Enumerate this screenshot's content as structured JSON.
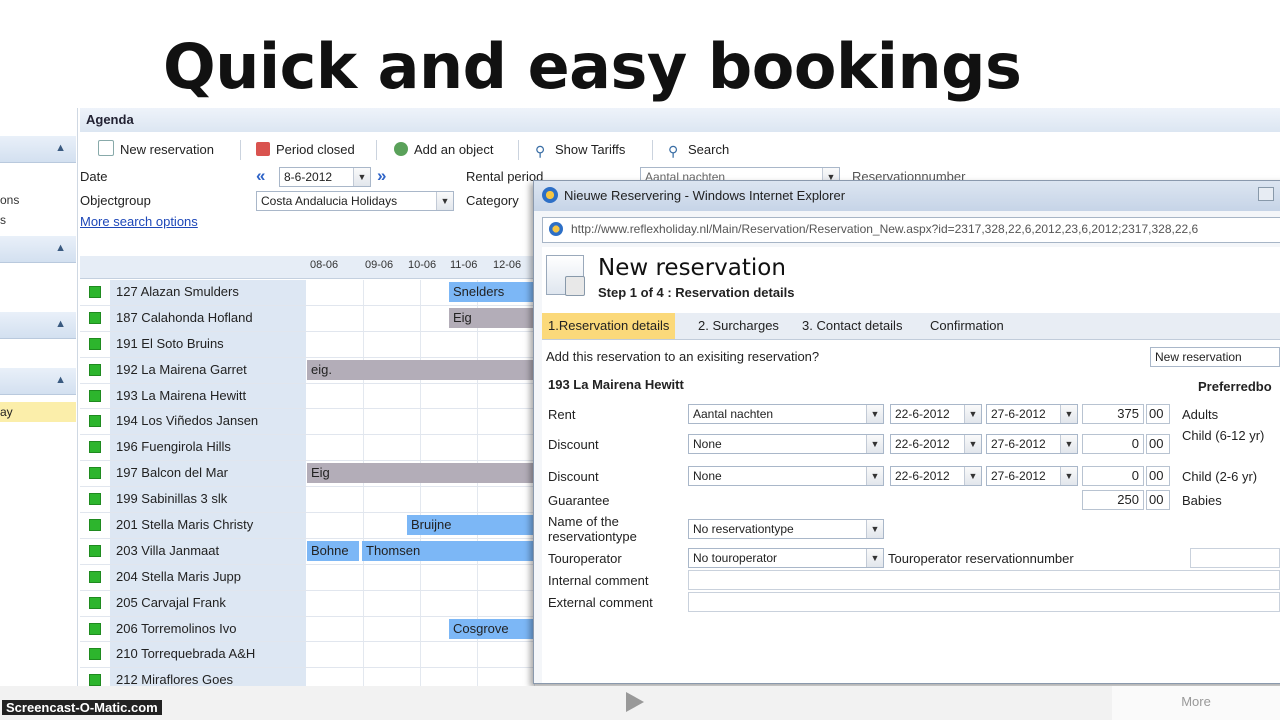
{
  "headline": "Quick and easy bookings",
  "left_panel": {
    "text_ons": "ons",
    "text_s": "s",
    "highlight": "ay"
  },
  "agenda": {
    "title": "Agenda",
    "toolbar": {
      "new_reservation": "New reservation",
      "period_closed": "Period closed",
      "add_object": "Add an object",
      "show_tariffs": "Show Tariffs",
      "search": "Search"
    },
    "filters": {
      "date_label": "Date",
      "date_value": "8-6-2012",
      "objectgroup_label": "Objectgroup",
      "objectgroup_value": "Costa Andalucia Holidays",
      "more_options": "More search options",
      "rental_period_label": "Rental period",
      "rental_period_value": "Aantal nachten",
      "category_label": "Category",
      "reservationnumber_label": "Reservationnumber"
    },
    "dates": [
      "08-06",
      "09-06",
      "10-06",
      "11-06",
      "12-06"
    ],
    "rows": [
      {
        "name": "127 Alazan Smulders",
        "bar": {
          "text": "Snelders",
          "color": "blue"
        }
      },
      {
        "name": "187 Calahonda Hofland",
        "bar": {
          "text": "Eig",
          "color": "gray"
        }
      },
      {
        "name": "191 El Soto Bruins"
      },
      {
        "name": "192 La Mairena Garret",
        "bar": {
          "text": "eig.",
          "color": "gray"
        }
      },
      {
        "name": "193 La Mairena Hewitt"
      },
      {
        "name": "194 Los Viñedos Jansen"
      },
      {
        "name": "196 Fuengirola Hills"
      },
      {
        "name": "197 Balcon del Mar",
        "bar": {
          "text": "Eig",
          "color": "gray"
        }
      },
      {
        "name": "199 Sabinillas 3 slk"
      },
      {
        "name": "201 Stella Maris Christy",
        "bar": {
          "text": "Bruijne",
          "color": "blue"
        }
      },
      {
        "name": "203 Villa Janmaat",
        "bar": {
          "text": "Bohne",
          "color": "blue"
        },
        "bar2": {
          "text": "Thomsen",
          "color": "blue"
        }
      },
      {
        "name": "204 Stella Maris Jupp"
      },
      {
        "name": "205 Carvajal Frank"
      },
      {
        "name": "206 Torremolinos Ivo",
        "bar": {
          "text": "Cosgrove",
          "color": "blue"
        }
      },
      {
        "name": "210 Torrequebrada A&H"
      },
      {
        "name": "212 Miraflores Goes"
      }
    ]
  },
  "popup": {
    "window_title": "Nieuwe Reservering - Windows Internet Explorer",
    "url": "http://www.reflexholiday.nl/Main/Reservation/Reservation_New.aspx?id=2317,328,22,6,2012,23,6,2012;2317,328,22,6",
    "heading": "New reservation",
    "step": "Step 1 of 4 : Reservation details",
    "tabs": [
      "1.Reservation details",
      "2. Surcharges",
      "3. Contact details",
      "Confirmation"
    ],
    "add_existing_label": "Add this reservation to an exisiting reservation?",
    "add_existing_value": "New reservation",
    "object_name": "193 La Mairena Hewitt",
    "preferred_label": "Preferredbo",
    "lines": [
      {
        "label": "Rent",
        "type": "Aantal nachten",
        "from": "22-6-2012",
        "to": "27-6-2012",
        "amount": "375",
        "cents": "00",
        "right": "Adults"
      },
      {
        "label": "Discount",
        "type": "None",
        "from": "22-6-2012",
        "to": "27-6-2012",
        "amount": "0",
        "cents": "00",
        "right": "Child (6-12 yr)"
      },
      {
        "label": "Discount",
        "type": "None",
        "from": "22-6-2012",
        "to": "27-6-2012",
        "amount": "0",
        "cents": "00",
        "right": "Child (2-6 yr)"
      }
    ],
    "guarantee": {
      "label": "Guarantee",
      "amount": "250",
      "cents": "00",
      "right": "Babies"
    },
    "reservationtype": {
      "label": "Name of the reservationtype",
      "value": "No reservationtype"
    },
    "touroperator": {
      "label": "Touroperator",
      "value": "No touroperator",
      "number_label": "Touroperator reservationnumber"
    },
    "internal_comment": "Internal comment",
    "external_comment": "External comment"
  },
  "bottom": {
    "watermark": "Screencast-O-Matic.com",
    "more": "More"
  }
}
